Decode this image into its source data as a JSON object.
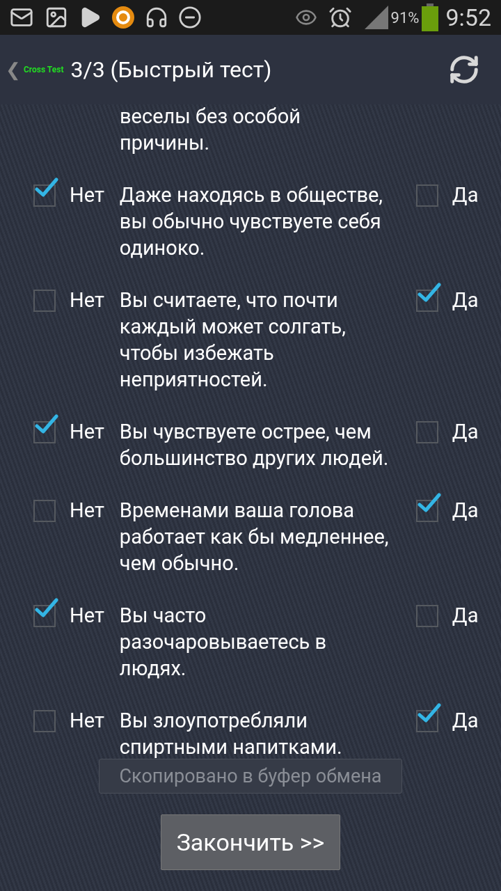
{
  "status_bar": {
    "battery": "91%",
    "time": "9:52"
  },
  "header": {
    "back": "❮",
    "app_name": "Cross Test",
    "title": "3/3 (Быстрый тест)"
  },
  "partial_question": "веселы без особой причины.",
  "questions": [
    {
      "text": "Даже находясь в обществе, вы обычно чувствуете себя одиноко.",
      "answers": [
        {
          "label": "Нет",
          "checked": true
        },
        {
          "label": "Да",
          "checked": false
        }
      ]
    },
    {
      "text": "Вы считаете, что почти каждый может солгать, чтобы избежать неприятностей.",
      "answers": [
        {
          "label": "Нет",
          "checked": false
        },
        {
          "label": "Да",
          "checked": true
        }
      ]
    },
    {
      "text": "Вы чувствуете острее, чем большинство других людей.",
      "answers": [
        {
          "label": "Нет",
          "checked": true
        },
        {
          "label": "Да",
          "checked": false
        }
      ]
    },
    {
      "text": "Временами ваша голова работает как бы медленнее, чем обычно.",
      "answers": [
        {
          "label": "Нет",
          "checked": false
        },
        {
          "label": "Да",
          "checked": true
        }
      ]
    },
    {
      "text": "Вы часто разочаровываетесь в людях.",
      "answers": [
        {
          "label": "Нет",
          "checked": true
        },
        {
          "label": "Да",
          "checked": false
        }
      ]
    },
    {
      "text": "Вы злоупотребляли спиртными напитками.",
      "answers": [
        {
          "label": "Нет",
          "checked": false
        },
        {
          "label": "Да",
          "checked": true
        }
      ]
    }
  ],
  "toast": "Скопировано в буфер обмена",
  "finish_button": "Закончить >>"
}
